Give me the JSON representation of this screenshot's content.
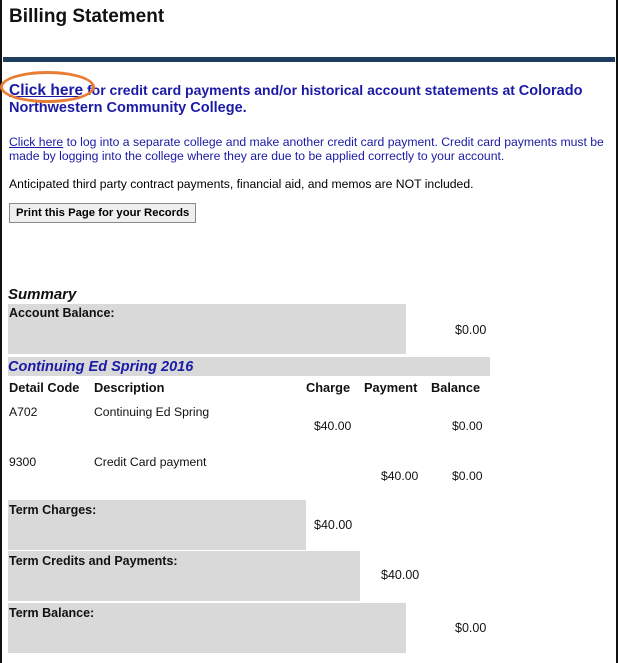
{
  "page": {
    "title": "Billing Statement"
  },
  "links": {
    "click_here_1": "Click here",
    "row1_rest": " for credit card payments and/or historical account statements at ",
    "college_name": "Colorado Northwestern Community College.",
    "click_here_2": "Click here",
    "row2_rest": " to log into a separate college and make another credit card payment. Credit card payments must be made by logging into the college where they are due to be applied correctly to your account."
  },
  "notice": "Anticipated third party contract payments, financial aid, and memos are NOT included.",
  "print_button": "Print this Page for your Records",
  "summary": {
    "heading": "Summary",
    "account_balance_label": "Account Balance:",
    "account_balance_value": "$0.00"
  },
  "term": {
    "title": "Continuing Ed Spring 2016",
    "columns": [
      "Detail Code",
      "Description",
      "Charge",
      "Payment",
      "Balance"
    ],
    "rows": [
      {
        "code": "A702",
        "description": "Continuing Ed Spring",
        "charge": "$40.00",
        "payment": "",
        "balance": "$0.00"
      },
      {
        "code": "9300",
        "description": "Credit Card payment",
        "charge": "",
        "payment": "$40.00",
        "balance": "$0.00"
      }
    ],
    "term_charges_label": "Term Charges:",
    "term_charges_value": "$40.00",
    "term_credits_label": "Term Credits and Payments:",
    "term_credits_value": "$40.00",
    "term_balance_label": "Term Balance:",
    "term_balance_value": "$0.00"
  },
  "colors": {
    "link": "#1a1aa6",
    "rule": "#1f3d5e",
    "highlight_circle": "#e87e35",
    "gray_cell": "#d9d9d9"
  }
}
